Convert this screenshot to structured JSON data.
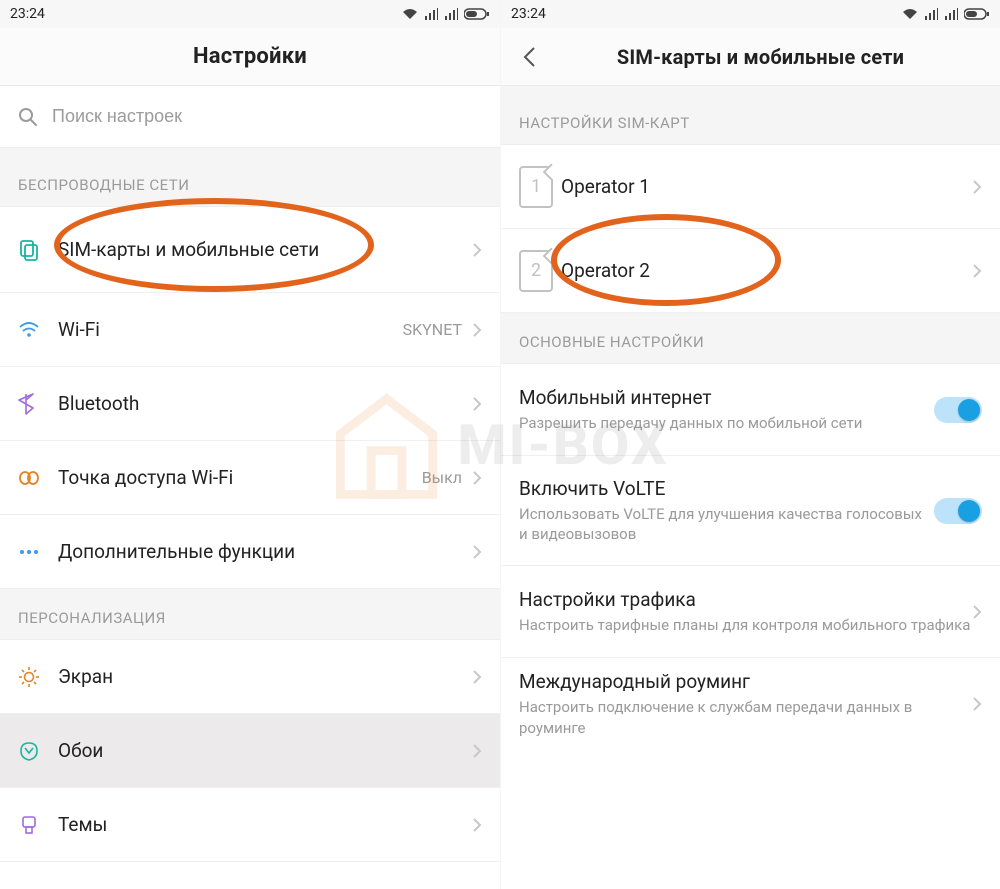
{
  "statusbar": {
    "time": "23:24"
  },
  "left": {
    "title": "Настройки",
    "search_placeholder": "Поиск настроек",
    "section_wireless": "БЕСПРОВОДНЫЕ СЕТИ",
    "section_personal": "ПЕРСОНАЛИЗАЦИЯ",
    "items": {
      "sim": "SIM-карты и мобильные сети",
      "wifi": "Wi-Fi",
      "wifi_value": "SKYNET",
      "bt": "Bluetooth",
      "hotspot": "Точка доступа Wi-Fi",
      "hotspot_value": "Выкл",
      "more": "Дополнительные функции",
      "display": "Экран",
      "wallpaper": "Обои",
      "themes": "Темы"
    }
  },
  "right": {
    "title": "SIM-карты и мобильные сети",
    "section_sim": "НАСТРОЙКИ SIM-КАРТ",
    "section_basic": "ОСНОВНЫЕ НАСТРОЙКИ",
    "sim1": {
      "num": "1",
      "name": "Operator 1"
    },
    "sim2": {
      "num": "2",
      "name": "Operator 2"
    },
    "mobile_data": {
      "title": "Мобильный интернет",
      "sub": "Разрешить передачу данных по мобильной сети",
      "on": true
    },
    "volte": {
      "title": "Включить VoLTE",
      "sub": "Использовать VoLTE для улучшения качества голосовых и видеовызовов",
      "on": true
    },
    "traffic": {
      "title": "Настройки трафика",
      "sub": "Настроить тарифные планы для контроля мобильного трафика"
    },
    "roaming": {
      "title": "Международный роуминг",
      "sub": "Настроить подключение к службам передачи данных в роуминге"
    }
  },
  "watermark": "MI-BOX"
}
